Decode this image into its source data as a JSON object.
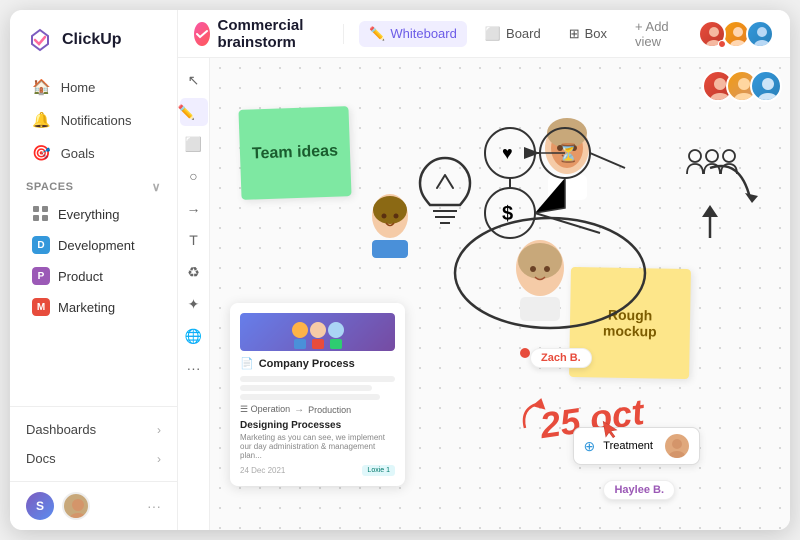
{
  "app": {
    "logo_text": "ClickUp"
  },
  "sidebar": {
    "nav_items": [
      {
        "id": "home",
        "label": "Home",
        "icon": "🏠"
      },
      {
        "id": "notifications",
        "label": "Notifications",
        "icon": "🔔"
      },
      {
        "id": "goals",
        "label": "Goals",
        "icon": "🎯"
      }
    ],
    "spaces_label": "Spaces",
    "spaces": [
      {
        "id": "everything",
        "label": "Everything",
        "color": "#888",
        "initial": ""
      },
      {
        "id": "development",
        "label": "Development",
        "color": "#3498db",
        "initial": "D"
      },
      {
        "id": "product",
        "label": "Product",
        "color": "#9b59b6",
        "initial": "P"
      },
      {
        "id": "marketing",
        "label": "Marketing",
        "color": "#e74c3c",
        "initial": "M"
      }
    ],
    "bottom_items": [
      {
        "id": "dashboards",
        "label": "Dashboards"
      },
      {
        "id": "docs",
        "label": "Docs"
      }
    ],
    "user_initial": "S"
  },
  "header": {
    "title": "Commercial brainstorm",
    "tabs": [
      {
        "id": "whiteboard",
        "label": "Whiteboard",
        "icon": "✏️",
        "active": true
      },
      {
        "id": "board",
        "label": "Board",
        "icon": "⬜"
      },
      {
        "id": "box",
        "label": "Box",
        "icon": "⊞"
      }
    ],
    "add_view": "+ Add view"
  },
  "canvas": {
    "sticky_green_text": "Team ideas",
    "sticky_yellow_text": "Rough mockup",
    "card_title": "Company Process",
    "card_subtitle": "Designing Processes",
    "card_badge": "Loxie 1",
    "zach_label": "Zach B.",
    "haylee_label": "Haylee B.",
    "treatment_label": "Treatment",
    "date_text": "25 oct"
  },
  "tools": [
    "↖",
    "✏️",
    "⬜",
    "○",
    "➡",
    "T",
    "♻",
    "✦",
    "🌐",
    "···"
  ]
}
